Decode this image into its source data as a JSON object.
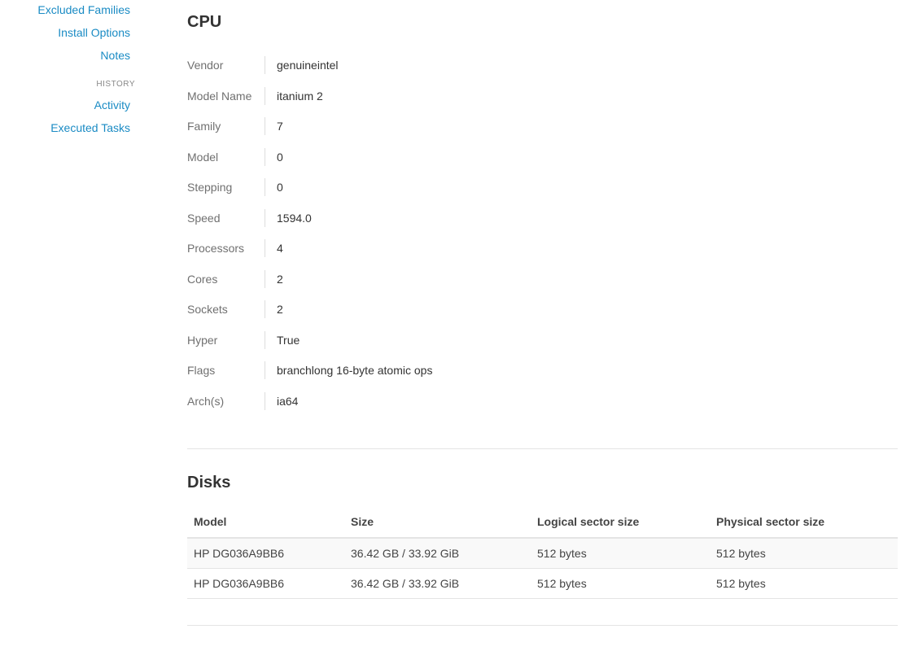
{
  "sidebar": {
    "links_top": [
      "Excluded Families",
      "Install Options",
      "Notes"
    ],
    "history_heading": "HISTORY",
    "links_history": [
      "Activity",
      "Executed Tasks"
    ]
  },
  "cpu": {
    "title": "CPU",
    "rows": [
      {
        "key": "Vendor",
        "value": "genuineintel"
      },
      {
        "key": "Model Name",
        "value": "itanium 2"
      },
      {
        "key": "Family",
        "value": "7"
      },
      {
        "key": "Model",
        "value": "0"
      },
      {
        "key": "Stepping",
        "value": "0"
      },
      {
        "key": "Speed",
        "value": "1594.0"
      },
      {
        "key": "Processors",
        "value": "4"
      },
      {
        "key": "Cores",
        "value": "2"
      },
      {
        "key": "Sockets",
        "value": "2"
      },
      {
        "key": "Hyper",
        "value": "True"
      },
      {
        "key": "Flags",
        "value": "branchlong 16-byte atomic ops"
      },
      {
        "key": "Arch(s)",
        "value": "ia64"
      }
    ]
  },
  "disks": {
    "title": "Disks",
    "columns": [
      "Model",
      "Size",
      "Logical sector size",
      "Physical sector size"
    ],
    "rows": [
      [
        "HP DG036A9BB6",
        "36.42 GB / 33.92 GiB",
        "512 bytes",
        "512 bytes"
      ],
      [
        "HP DG036A9BB6",
        "36.42 GB / 33.92 GiB",
        "512 bytes",
        "512 bytes"
      ]
    ]
  },
  "colors": {
    "link": "#1a8bc4",
    "text": "#333333",
    "muted": "#707070",
    "divider": "#e4e4e4"
  }
}
